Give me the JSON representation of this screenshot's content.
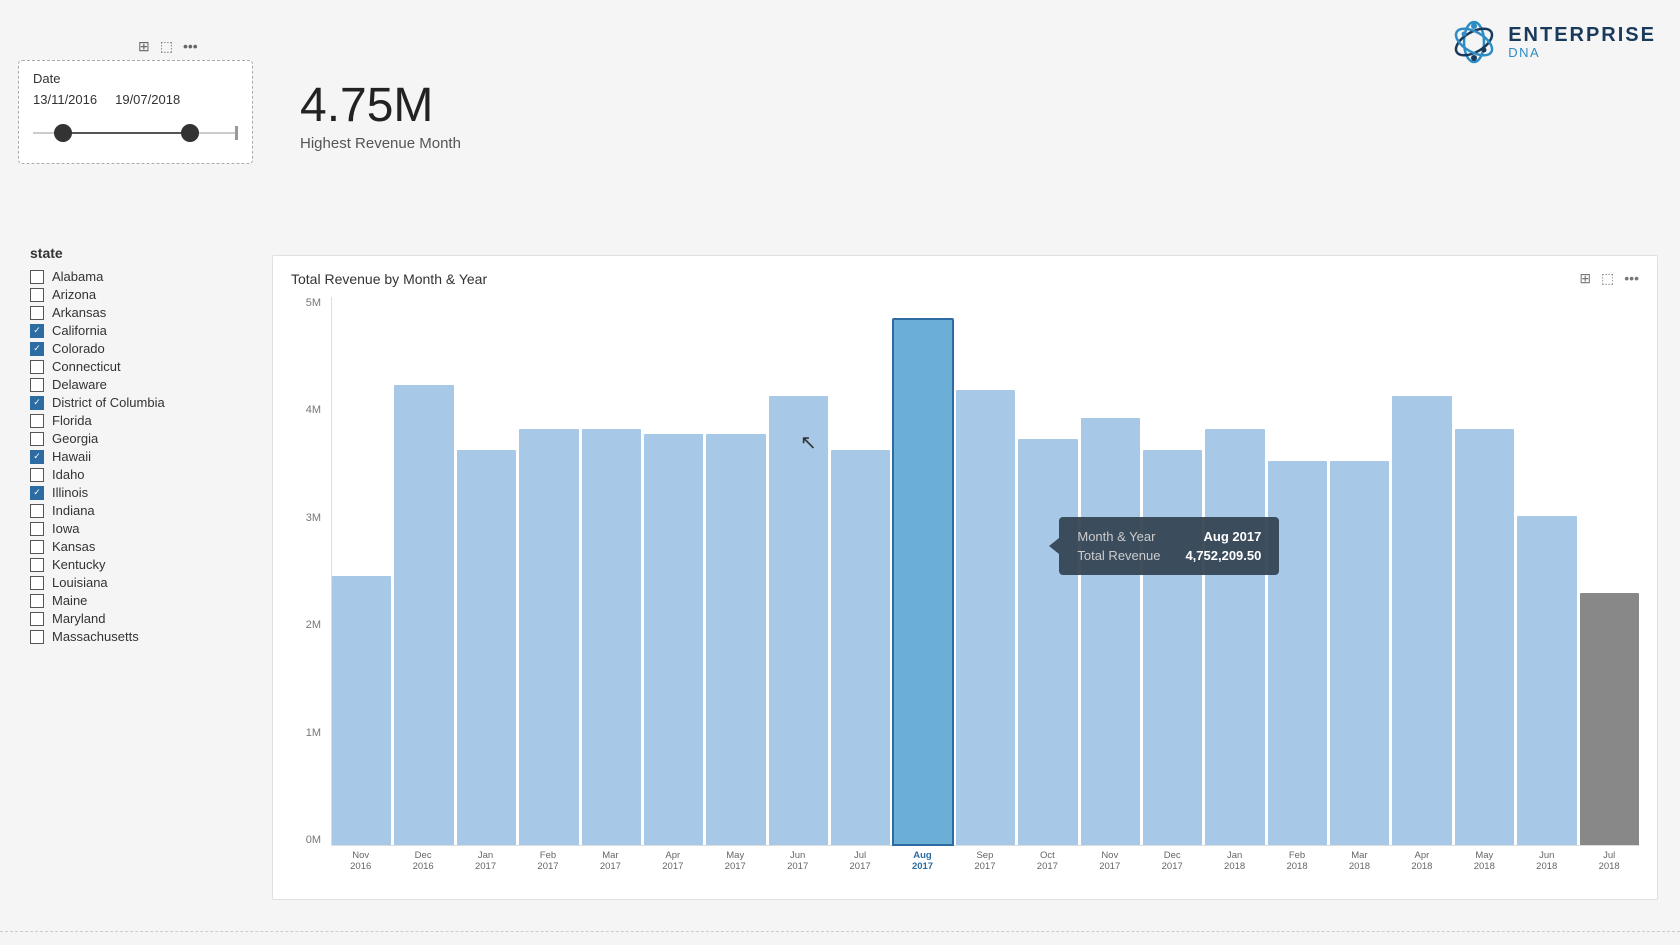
{
  "header": {
    "logo_text_1": "ENTERPRISE",
    "logo_text_2": "DNA"
  },
  "date_filter": {
    "label": "Date",
    "start": "13/11/2016",
    "end": "19/07/2018",
    "icons": [
      "filter",
      "export",
      "more"
    ]
  },
  "metric": {
    "value": "4.75M",
    "label": "Highest Revenue Month"
  },
  "state_filter": {
    "title": "state",
    "states": [
      {
        "name": "Alabama",
        "checked": false
      },
      {
        "name": "Arizona",
        "checked": false
      },
      {
        "name": "Arkansas",
        "checked": false
      },
      {
        "name": "California",
        "checked": true
      },
      {
        "name": "Colorado",
        "checked": true
      },
      {
        "name": "Connecticut",
        "checked": false
      },
      {
        "name": "Delaware",
        "checked": false
      },
      {
        "name": "District of Columbia",
        "checked": true
      },
      {
        "name": "Florida",
        "checked": false
      },
      {
        "name": "Georgia",
        "checked": false
      },
      {
        "name": "Hawaii",
        "checked": true
      },
      {
        "name": "Idaho",
        "checked": false
      },
      {
        "name": "Illinois",
        "checked": true
      },
      {
        "name": "Indiana",
        "checked": false
      },
      {
        "name": "Iowa",
        "checked": false
      },
      {
        "name": "Kansas",
        "checked": false
      },
      {
        "name": "Kentucky",
        "checked": false
      },
      {
        "name": "Louisiana",
        "checked": false
      },
      {
        "name": "Maine",
        "checked": false
      },
      {
        "name": "Maryland",
        "checked": false
      },
      {
        "name": "Massachusetts",
        "checked": false
      }
    ]
  },
  "chart": {
    "title": "Total Revenue by Month & Year",
    "y_labels": [
      "5M",
      "4M",
      "3M",
      "2M",
      "1M",
      "0M"
    ],
    "tooltip": {
      "month_year_label": "Month & Year",
      "month_year_value": "Aug 2017",
      "revenue_label": "Total Revenue",
      "revenue_value": "4,752,209.50"
    },
    "bars": [
      {
        "label": "Nov",
        "year": "2016",
        "height_pct": 49,
        "highlighted": false,
        "dark": false
      },
      {
        "label": "Dec",
        "year": "2016",
        "height_pct": 84,
        "highlighted": false,
        "dark": false
      },
      {
        "label": "Jan",
        "year": "2017",
        "height_pct": 72,
        "highlighted": false,
        "dark": false
      },
      {
        "label": "Feb",
        "year": "2017",
        "height_pct": 76,
        "highlighted": false,
        "dark": false
      },
      {
        "label": "Mar",
        "year": "2017",
        "height_pct": 76,
        "highlighted": false,
        "dark": false
      },
      {
        "label": "Apr",
        "year": "2017",
        "height_pct": 75,
        "highlighted": false,
        "dark": false
      },
      {
        "label": "May",
        "year": "2017",
        "height_pct": 75,
        "highlighted": false,
        "dark": false
      },
      {
        "label": "Jun",
        "year": "2017",
        "height_pct": 82,
        "highlighted": false,
        "dark": false
      },
      {
        "label": "Jul",
        "year": "2017",
        "height_pct": 72,
        "highlighted": false,
        "dark": false
      },
      {
        "label": "Aug",
        "year": "2017",
        "height_pct": 96,
        "highlighted": true,
        "dark": false
      },
      {
        "label": "Sep",
        "year": "2017",
        "height_pct": 83,
        "highlighted": false,
        "dark": false
      },
      {
        "label": "Oct",
        "year": "2017",
        "height_pct": 74,
        "highlighted": false,
        "dark": false
      },
      {
        "label": "Nov",
        "year": "2017",
        "height_pct": 78,
        "highlighted": false,
        "dark": false
      },
      {
        "label": "Dec",
        "year": "2017",
        "height_pct": 72,
        "highlighted": false,
        "dark": false
      },
      {
        "label": "Jan",
        "year": "2018",
        "height_pct": 76,
        "highlighted": false,
        "dark": false
      },
      {
        "label": "Feb",
        "year": "2018",
        "height_pct": 70,
        "highlighted": false,
        "dark": false
      },
      {
        "label": "Mar",
        "year": "2018",
        "height_pct": 70,
        "highlighted": false,
        "dark": false
      },
      {
        "label": "Apr",
        "year": "2018",
        "height_pct": 82,
        "highlighted": false,
        "dark": false
      },
      {
        "label": "May",
        "year": "2018",
        "height_pct": 76,
        "highlighted": false,
        "dark": false
      },
      {
        "label": "Jun",
        "year": "2018",
        "height_pct": 60,
        "highlighted": false,
        "dark": false
      },
      {
        "label": "Jul",
        "year": "2018",
        "height_pct": 46,
        "highlighted": false,
        "dark": true
      }
    ]
  }
}
